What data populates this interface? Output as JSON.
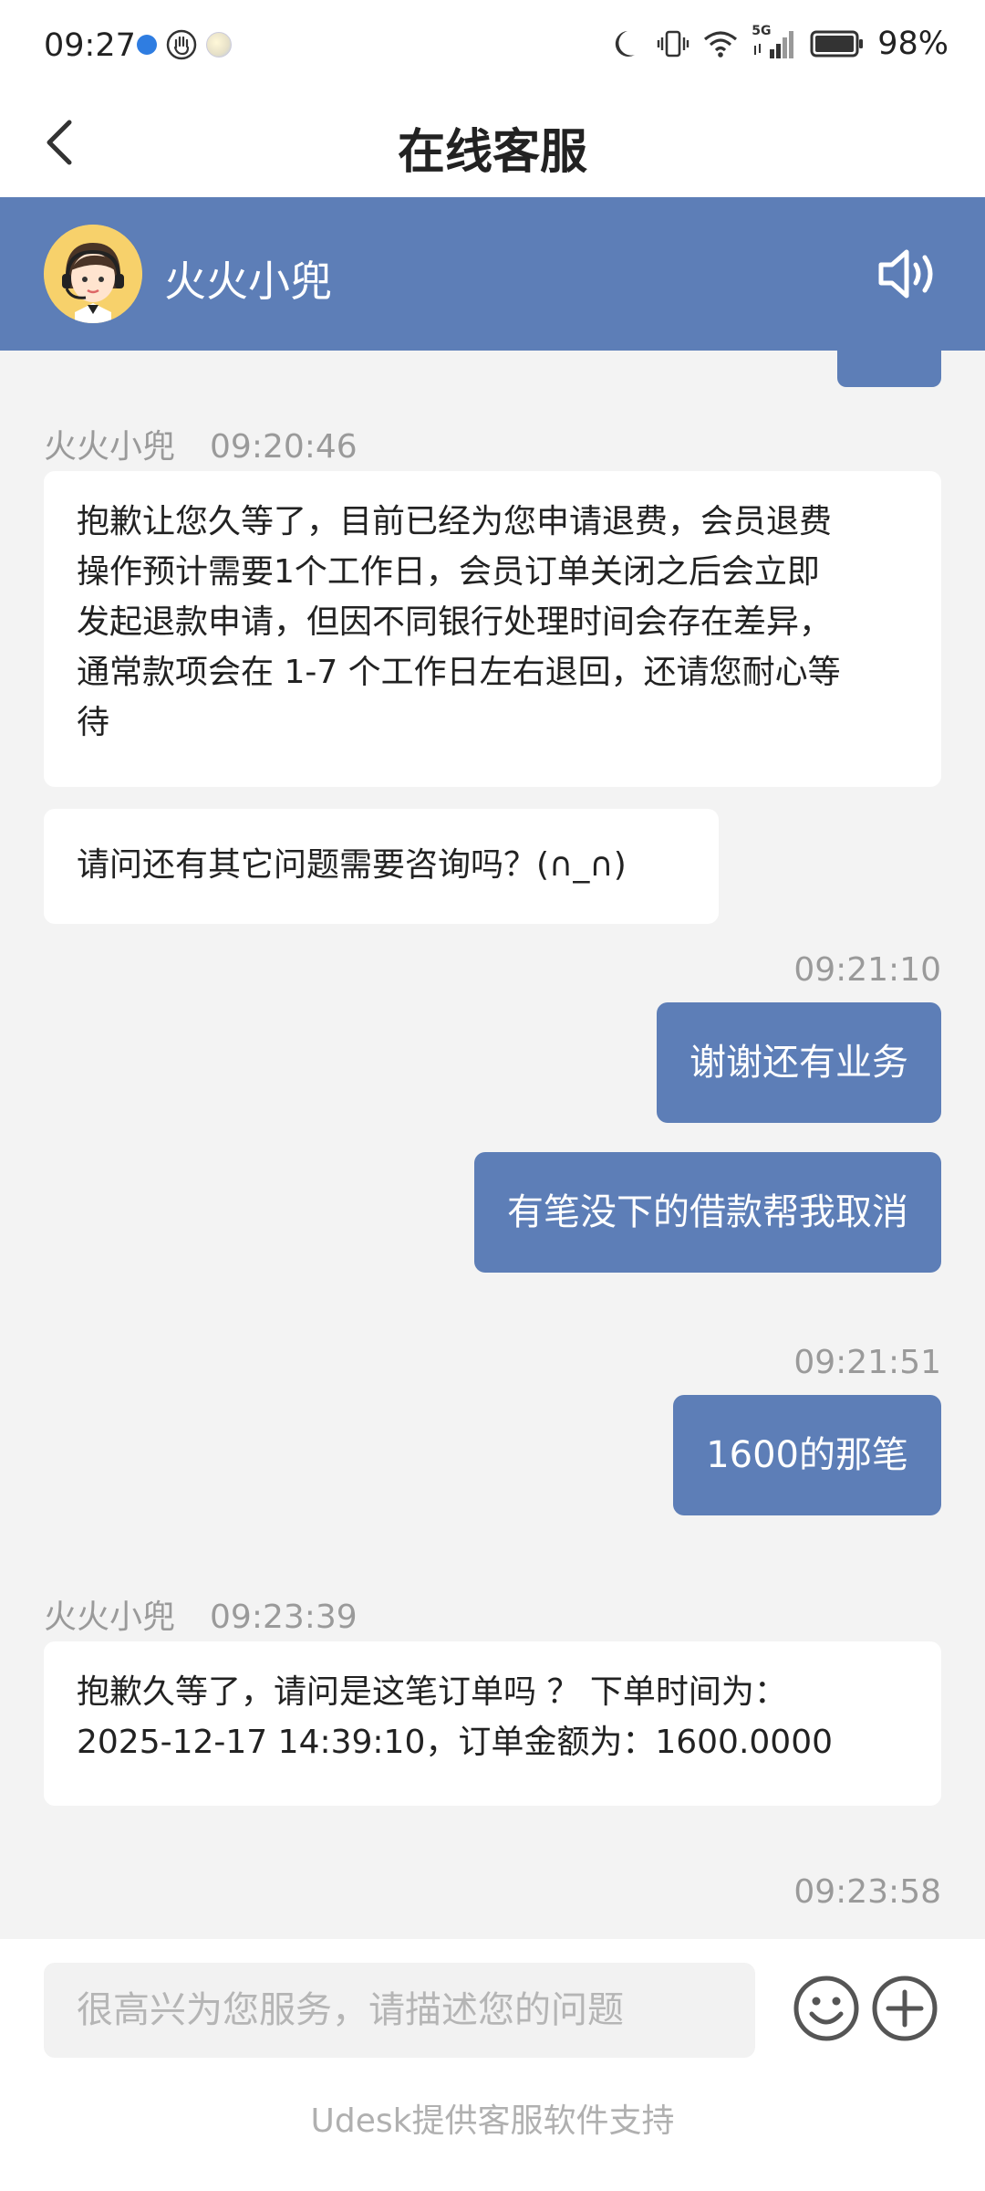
{
  "status_bar": {
    "time": "09:27",
    "battery_percent": "98%",
    "network_label": "5G",
    "icons": [
      "blue-dot-icon",
      "hand-icon",
      "moon-app-icon",
      "do-not-disturb-moon-icon",
      "vibrate-icon",
      "wifi-icon",
      "signal-icon",
      "battery-icon"
    ]
  },
  "header": {
    "title": "在线客服",
    "back_icon": "chevron-left-icon"
  },
  "agent": {
    "name": "火火小兜",
    "avatar_icon": "customer-service-avatar",
    "speaker_icon": "speaker-icon"
  },
  "messages": [
    {
      "sender": "火火小兜",
      "time": "09:20:46",
      "lines": [
        "抱歉让您久等了，目前已经为您申请退费，会员退费",
        "操作预计需要1个工作日，会员订单关闭之后会立即",
        "发起退款申请，但因不同银行处理时间会存在差异，",
        "通常款项会在 1-7 个工作日左右退回，还请您耐心等",
        "待"
      ]
    },
    {
      "text": "请问还有其它问题需要咨询吗？(∩_∩)"
    },
    {
      "time": "09:21:10",
      "text": "谢谢还有业务"
    },
    {
      "text": "有笔没下的借款帮我取消"
    },
    {
      "time": "09:21:51",
      "text": "1600的那笔"
    },
    {
      "sender": "火火小兜",
      "time": "09:23:39",
      "lines": [
        "抱歉久等了，请问是这笔订单吗 ？ 下单时间为：",
        "2025-12-17 14:39:10，订单金额为：1600.0000"
      ]
    },
    {
      "time": "09:23:58"
    }
  ],
  "input": {
    "placeholder": "很高兴为您服务，请描述您的问题",
    "emoji_icon": "smiley-icon",
    "plus_icon": "plus-circle-icon"
  },
  "footer": {
    "powered_by": "Udesk提供客服软件支持"
  },
  "colors": {
    "accent": "#5d7eb7",
    "chat_background": "#f3f3f3",
    "incoming_bubble": "#ffffff",
    "meta_text": "#9a9a9a"
  }
}
